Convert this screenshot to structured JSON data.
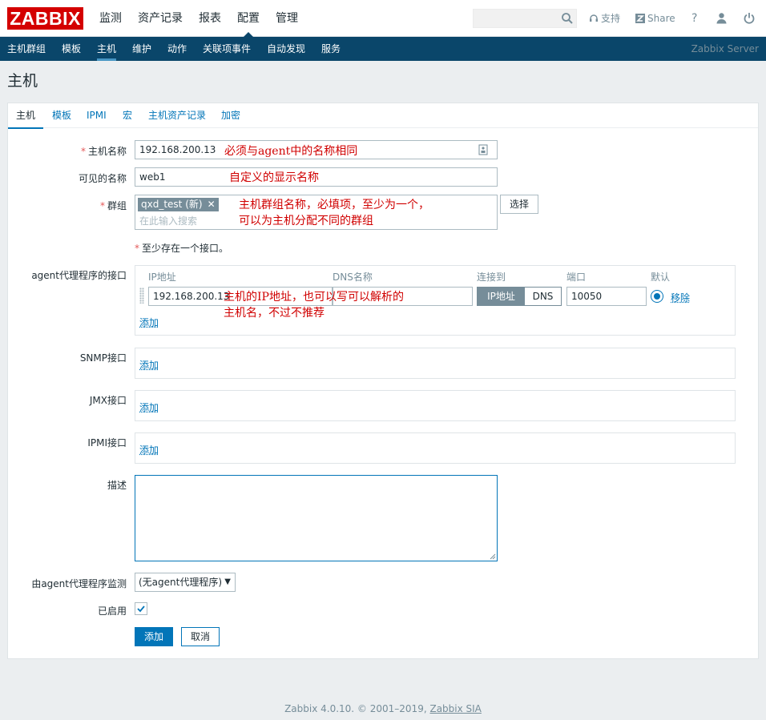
{
  "header": {
    "logo": "ZABBIX",
    "menu": [
      "监测",
      "资产记录",
      "报表",
      "配置",
      "管理"
    ],
    "active_menu": "配置",
    "support": "支持",
    "share": "Share",
    "help": "?"
  },
  "subnav": {
    "items": [
      "主机群组",
      "模板",
      "主机",
      "维护",
      "动作",
      "关联项事件",
      "自动发现",
      "服务"
    ],
    "active": "主机",
    "server": "Zabbix Server"
  },
  "page_title": "主机",
  "tabs": [
    "主机",
    "模板",
    "IPMI",
    "宏",
    "主机资产记录",
    "加密"
  ],
  "form": {
    "host_name_label": "主机名称",
    "host_name_value": "192.168.200.13",
    "visible_name_label": "可见的名称",
    "visible_name_value": "web1",
    "groups_label": "群组",
    "group_tag": "qxd_test (新)",
    "groups_placeholder": "在此输入搜索",
    "select_button": "选择",
    "interface_required": "至少存在一个接口。",
    "agent_label": "agent代理程序的接口",
    "columns": {
      "ip": "IP地址",
      "dns": "DNS名称",
      "connect": "连接到",
      "port": "端口",
      "default": "默认"
    },
    "agent_ip": "192.168.200.13",
    "agent_dns": "",
    "connect_ip": "IP地址",
    "connect_dns": "DNS",
    "agent_port": "10050",
    "remove": "移除",
    "add": "添加",
    "snmp_label": "SNMP接口",
    "jmx_label": "JMX接口",
    "ipmi_label": "IPMI接口",
    "description_label": "描述",
    "description_value": "",
    "proxy_label": "由agent代理程序监测",
    "proxy_value": "(无agent代理程序)",
    "enabled_label": "已启用",
    "enabled": true,
    "submit": "添加",
    "cancel": "取消"
  },
  "annotations": {
    "host_name_note": "必须与agent中的名称相同",
    "visible_name_note": "自定义的显示名称",
    "group_note_line1": "主机群组名称，必填项，至少为一个，",
    "group_note_line2": "可以为主机分配不同的群组",
    "ip_note_line1": "主机的IP地址，也可以写可以解析的",
    "ip_note_line2": "主机名，不过不推荐"
  },
  "footer": {
    "text": "Zabbix 4.0.10. © 2001–2019,",
    "link": "Zabbix SIA"
  },
  "colors": {
    "brand_red": "#d40000",
    "nav_blue": "#0a466a",
    "link_blue": "#0275b8",
    "annotation_red": "#d00000"
  }
}
